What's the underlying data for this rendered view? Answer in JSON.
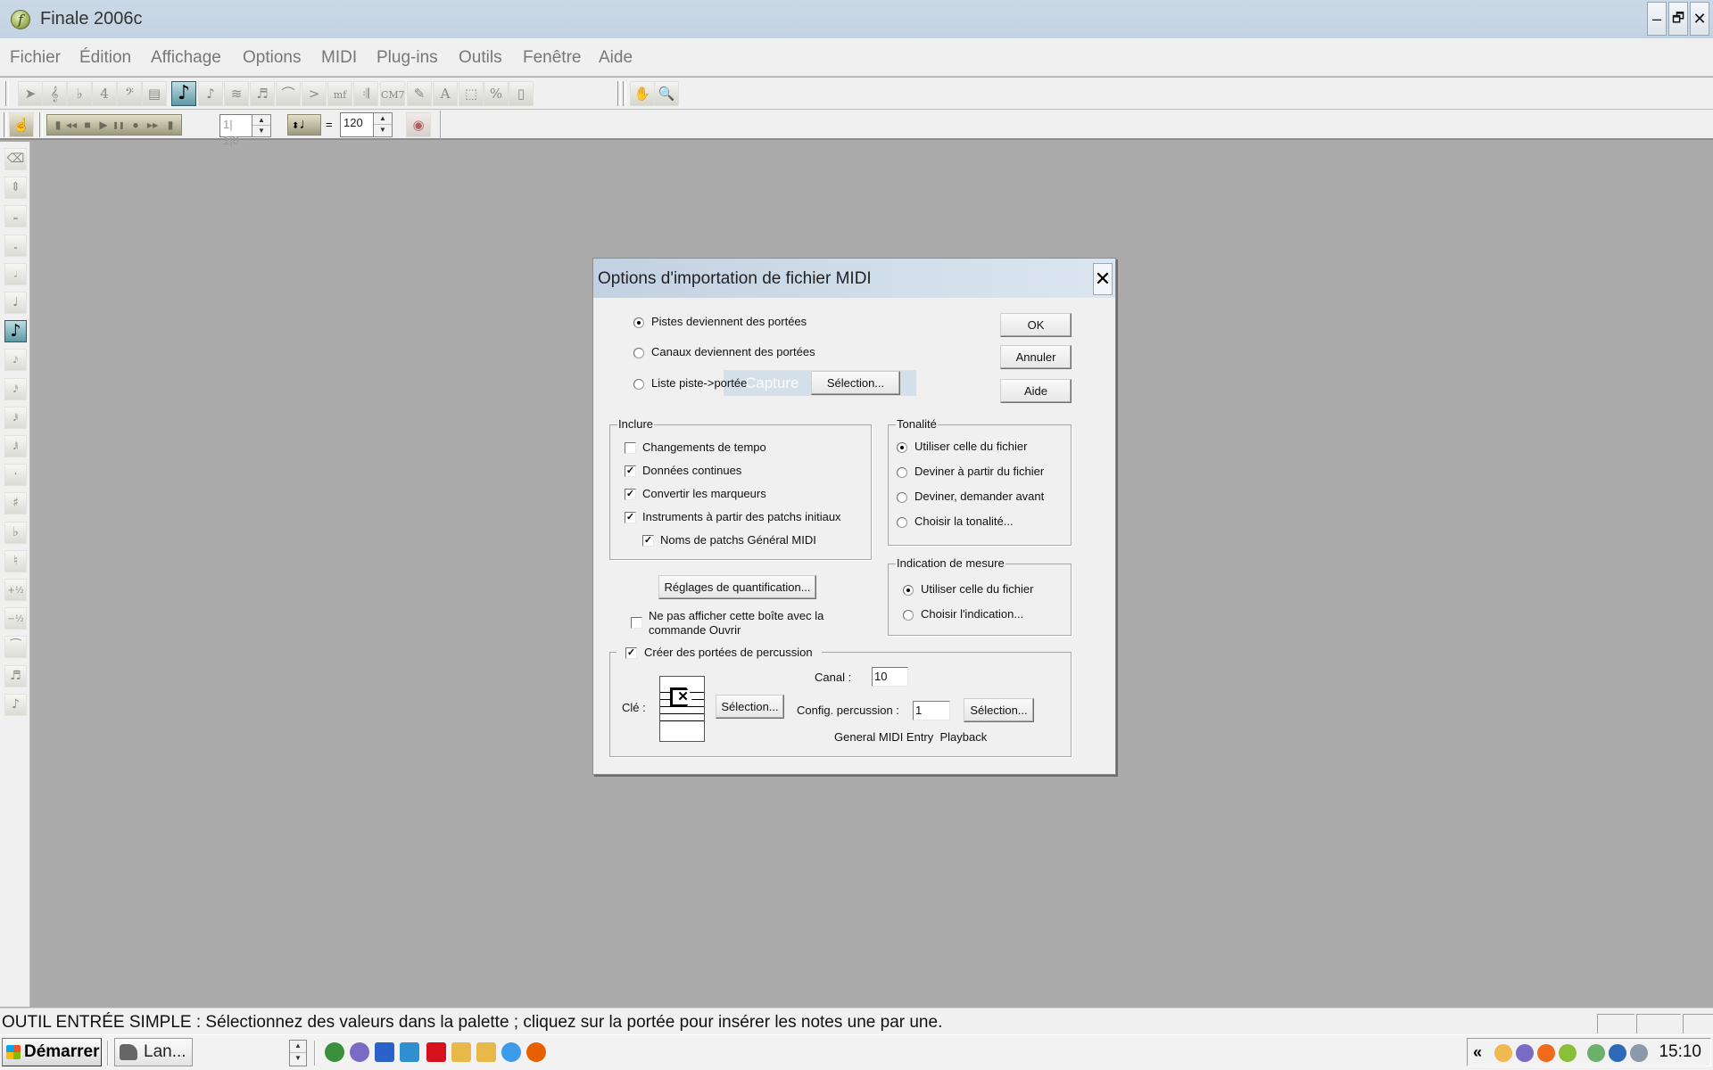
{
  "window": {
    "title": "Finale 2006c",
    "controls": {
      "minimize": "–",
      "restore": "🗗",
      "close": "✕"
    }
  },
  "menu": [
    "Fichier",
    "Édition",
    "Affichage",
    "Options",
    "MIDI",
    "Plug-ins",
    "Outils",
    "Fenêtre",
    "Aide"
  ],
  "main_toolbar": {
    "tools": [
      {
        "name": "selection-tool-icon",
        "glyph": "➤"
      },
      {
        "name": "staff-tool-icon",
        "glyph": "𝄞"
      },
      {
        "name": "key-signature-tool-icon",
        "glyph": "♭"
      },
      {
        "name": "time-signature-tool-icon",
        "glyph": "4"
      },
      {
        "name": "clef-tool-icon",
        "glyph": "𝄢"
      },
      {
        "name": "measure-tool-icon",
        "glyph": "▤"
      },
      {
        "name": "simple-entry-tool-icon",
        "glyph": "♪",
        "active": true
      },
      {
        "name": "speedy-entry-tool-icon",
        "glyph": "♪"
      },
      {
        "name": "hyperscribe-tool-icon",
        "glyph": "≋"
      },
      {
        "name": "tuplet-tool-icon",
        "glyph": "♬"
      },
      {
        "name": "smart-shape-tool-icon",
        "glyph": "⌒"
      },
      {
        "name": "articulation-tool-icon",
        "glyph": ">"
      },
      {
        "name": "expression-tool-icon",
        "glyph": "mf"
      },
      {
        "name": "repeat-tool-icon",
        "glyph": "𝄇"
      },
      {
        "name": "chord-tool-icon",
        "glyph": "CM7"
      },
      {
        "name": "lyrics-tool-icon",
        "glyph": "✎"
      },
      {
        "name": "text-tool-icon",
        "glyph": "A"
      },
      {
        "name": "graphics-tool-icon",
        "glyph": "⬚"
      },
      {
        "name": "resize-tool-icon",
        "glyph": "%"
      },
      {
        "name": "page-layout-tool-icon",
        "glyph": "▯"
      },
      {
        "name": "hand-grabber-tool-icon",
        "glyph": "✋"
      },
      {
        "name": "zoom-tool-icon",
        "glyph": "🔍"
      }
    ]
  },
  "playback_toolbar": {
    "controls": [
      {
        "name": "rewind-to-start-icon",
        "glyph": "▮"
      },
      {
        "name": "rewind-icon",
        "glyph": "◀◀"
      },
      {
        "name": "stop-icon",
        "glyph": "■"
      },
      {
        "name": "play-icon",
        "glyph": "▶"
      },
      {
        "name": "pause-icon",
        "glyph": "❚❚"
      },
      {
        "name": "record-icon",
        "glyph": "●"
      },
      {
        "name": "fast-forward-icon",
        "glyph": "▶▶"
      },
      {
        "name": "forward-to-end-icon",
        "glyph": "▮"
      }
    ],
    "measure_counter": "1| 1|0",
    "tempo_equals": "=",
    "tempo_value": "120",
    "tempo_note_glyph": "♩"
  },
  "palette": [
    {
      "name": "eraser-icon",
      "glyph": "⌫"
    },
    {
      "name": "half-step-icon",
      "glyph": "⇕"
    },
    {
      "name": "double-whole-note-icon",
      "glyph": "𝅜"
    },
    {
      "name": "whole-note-icon",
      "glyph": "𝅝"
    },
    {
      "name": "half-note-icon",
      "glyph": "𝅗𝅥"
    },
    {
      "name": "quarter-note-icon",
      "glyph": "♩"
    },
    {
      "name": "eighth-note-icon",
      "glyph": "♪",
      "active": true
    },
    {
      "name": "sixteenth-note-icon",
      "glyph": "𝅘𝅥𝅯"
    },
    {
      "name": "thirty-second-note-icon",
      "glyph": "𝅘𝅥𝅰"
    },
    {
      "name": "sixty-fourth-note-icon",
      "glyph": "𝅘𝅥𝅱"
    },
    {
      "name": "128th-note-icon",
      "glyph": "𝅘𝅥𝅲"
    },
    {
      "name": "dot-icon",
      "glyph": "·"
    },
    {
      "name": "sharp-icon",
      "glyph": "♯"
    },
    {
      "name": "flat-icon",
      "glyph": "♭"
    },
    {
      "name": "natural-icon",
      "glyph": "♮"
    },
    {
      "name": "half-step-up-icon",
      "glyph": "+½"
    },
    {
      "name": "half-step-down-icon",
      "glyph": "−½"
    },
    {
      "name": "tie-icon",
      "glyph": "⁀"
    },
    {
      "name": "tuplet-icon",
      "glyph": "♬"
    },
    {
      "name": "grace-note-icon",
      "glyph": "♪"
    }
  ],
  "dialog": {
    "title": "Options d'importation de fichier MIDI",
    "close": "✕",
    "mode_options": [
      {
        "label": "Pistes deviennent des portées",
        "selected": true
      },
      {
        "label": "Canaux deviennent des portées",
        "selected": false
      },
      {
        "label": "Liste piste->portée",
        "selected": false
      }
    ],
    "mode_selection_button": "Sélection...",
    "capture_overlay_text": "Capture",
    "buttons": {
      "ok": "OK",
      "cancel": "Annuler",
      "help": "Aide"
    },
    "include_group": {
      "legend": "Inclure",
      "items": [
        {
          "label": "Changements de tempo",
          "checked": false
        },
        {
          "label": "Données continues",
          "checked": true
        },
        {
          "label": "Convertir les marqueurs",
          "checked": true
        },
        {
          "label": "Instruments à partir des patchs initiaux",
          "checked": true
        },
        {
          "label": "Noms de patchs Général MIDI",
          "checked": true
        }
      ]
    },
    "key_group": {
      "legend": "Tonalité",
      "options": [
        {
          "label": "Utiliser celle du fichier",
          "selected": true
        },
        {
          "label": "Deviner à partir du fichier",
          "selected": false
        },
        {
          "label": "Deviner, demander avant",
          "selected": false
        },
        {
          "label": "Choisir la tonalité...",
          "selected": false
        }
      ]
    },
    "time_sig_group": {
      "legend": "Indication de mesure",
      "options": [
        {
          "label": "Utiliser celle du fichier",
          "selected": true
        },
        {
          "label": "Choisir l'indication...",
          "selected": false
        }
      ]
    },
    "quantize_button": "Réglages de quantification...",
    "dont_show": {
      "label_line1": "Ne pas afficher cette boîte avec la",
      "label_line2": "commande Ouvrir",
      "checked": false
    },
    "percussion_group": {
      "legend": "Créer des portées de percussion",
      "checked": true,
      "channel_label": "Canal :",
      "channel_value": "10",
      "clef_label": "Clé :",
      "clef_select_button": "Sélection...",
      "config_label": "Config. percussion :",
      "config_value": "1",
      "config_select_button": "Sélection...",
      "config_name": "General MIDI Entry  Playback"
    }
  },
  "status_bar": {
    "text": "OUTIL ENTRÉE SIMPLE : Sélectionnez des valeurs dans la palette ; cliquez sur la portée pour insérer les notes une par une."
  },
  "taskbar": {
    "start_label": "Démarrer",
    "task_label": "Lan...",
    "quick_launch": [
      {
        "name": "chrome-icon",
        "color": "#3a8f3a"
      },
      {
        "name": "torrent-client-icon",
        "color": "#7a6bc4"
      },
      {
        "name": "desktop-icon",
        "color": "#2a62c9"
      },
      {
        "name": "media-player-icon",
        "color": "#2f8fd0"
      },
      {
        "name": "sfr-icon",
        "color": "#d6111c"
      },
      {
        "name": "mail-icon",
        "color": "#e8b84a"
      },
      {
        "name": "mail-alt-icon",
        "color": "#e8b84a"
      },
      {
        "name": "internet-explorer-icon",
        "color": "#3d9be9"
      },
      {
        "name": "firefox-icon",
        "color": "#e66000"
      }
    ],
    "tray_expand": "«",
    "tray_icons": [
      {
        "name": "mail-tray-icon",
        "color": "#f0b850"
      },
      {
        "name": "torrent-tray-icon",
        "color": "#7a6bc4"
      },
      {
        "name": "avast-tray-icon",
        "color": "#ef6a1a"
      },
      {
        "name": "download-tray-icon",
        "color": "#8bbf3a"
      },
      {
        "name": "power-tray-icon",
        "color": "#6bb16b"
      },
      {
        "name": "network-tray-icon",
        "color": "#2d6bb8"
      },
      {
        "name": "volume-tray-icon",
        "color": "#8a9aa8"
      }
    ],
    "clock": "15:10"
  }
}
